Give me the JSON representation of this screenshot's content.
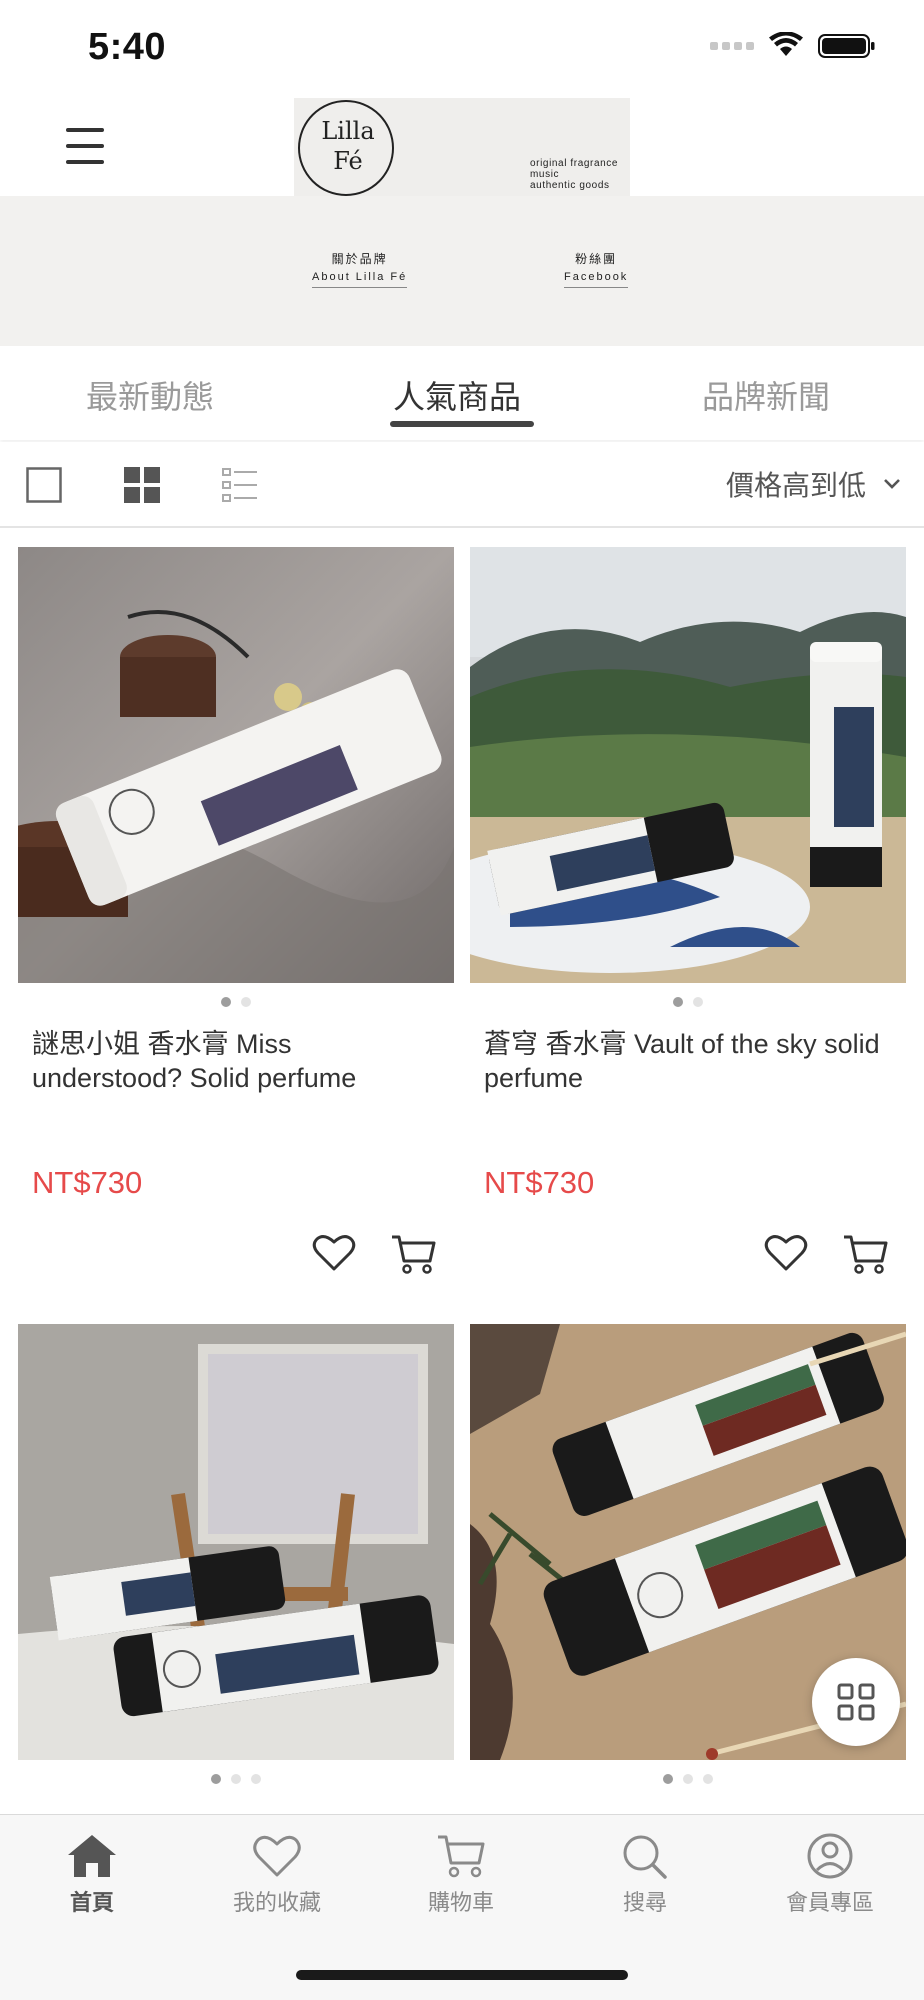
{
  "status_bar": {
    "time": "5:40"
  },
  "brand": {
    "logo_mark": [
      "Lilla",
      "Fé"
    ],
    "tagline": [
      "original fragrance",
      "music",
      "authentic goods"
    ]
  },
  "banner": {
    "links": [
      {
        "zh": "關於品牌",
        "en": "About Lilla Fé"
      },
      {
        "zh": "粉絲團",
        "en": "Facebook"
      }
    ]
  },
  "tabs": [
    {
      "label": "最新動態",
      "active": false
    },
    {
      "label": "人氣商品",
      "active": true
    },
    {
      "label": "品牌新聞",
      "active": false
    }
  ],
  "toolbar": {
    "views": [
      "single-view-icon",
      "grid-view-icon",
      "list-view-icon"
    ],
    "active_view": "grid",
    "sort_label": "價格高到低"
  },
  "products": [
    {
      "name": "謎思小姐 香水膏 Miss understood? Solid perfume",
      "price": "NT$730",
      "image_count": 2,
      "active_image": 1
    },
    {
      "name": "蒼穹 香水膏 Vault of the sky solid perfume",
      "price": "NT$730",
      "image_count": 2,
      "active_image": 1
    },
    {
      "name": "",
      "price": "",
      "image_count": 3,
      "active_image": 1
    },
    {
      "name": "",
      "price": "",
      "image_count": 3,
      "active_image": 1
    }
  ],
  "tabbar": [
    {
      "label": "首頁",
      "icon": "home-icon",
      "active": true
    },
    {
      "label": "我的收藏",
      "icon": "heart-icon",
      "active": false
    },
    {
      "label": "購物車",
      "icon": "cart-icon",
      "active": false
    },
    {
      "label": "搜尋",
      "icon": "search-icon",
      "active": false
    },
    {
      "label": "會員專區",
      "icon": "user-icon",
      "active": false
    }
  ],
  "colors": {
    "price": "#e64a4a",
    "accent": "#444444",
    "banner_bg": "#f2f1ef"
  }
}
